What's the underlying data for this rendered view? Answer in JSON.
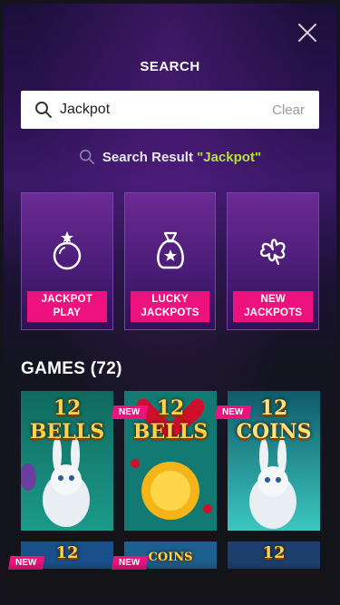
{
  "modal": {
    "title": "SEARCH"
  },
  "search": {
    "value": "Jackpot",
    "clear_label": "Clear"
  },
  "result": {
    "prefix": "Search Result",
    "query": "\"Jackpot\""
  },
  "categories": [
    {
      "label": "JACKPOT PLAY",
      "icon": "bomb-icon"
    },
    {
      "label": "LUCKY\nJACKPOTS",
      "icon": "money-bag-icon"
    },
    {
      "label": "NEW\nJACKPOTS",
      "icon": "clover-icon"
    }
  ],
  "games": {
    "title": "GAMES (72)",
    "badge": "NEW",
    "tiles": [
      {
        "logo": "12 BELLS",
        "new": false
      },
      {
        "logo": "12 BELLS",
        "new": true
      },
      {
        "logo": "12 COINS",
        "new": true
      },
      {
        "logo": "12",
        "new": true
      },
      {
        "logo": "COINS",
        "new": true
      },
      {
        "logo": "12",
        "new": false
      }
    ]
  },
  "colors": {
    "accent_pink": "#ee127f",
    "query_green": "#b6e23a"
  }
}
